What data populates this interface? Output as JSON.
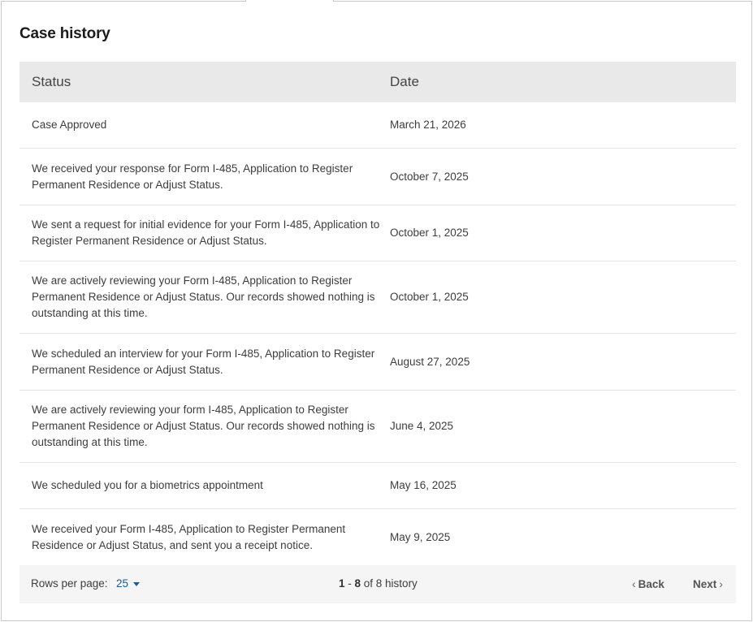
{
  "section_title": "Case history",
  "table": {
    "headers": {
      "status": "Status",
      "date": "Date"
    },
    "rows": [
      {
        "status": "Case Approved",
        "date": "March 21, 2026"
      },
      {
        "status": "We received your response for Form I-485, Application to Register Permanent Residence or Adjust Status.",
        "date": "October 7, 2025"
      },
      {
        "status": "We sent a request for initial evidence for your Form I-485, Application to Register Permanent Residence or Adjust Status.",
        "date": "October 1, 2025"
      },
      {
        "status": "We are actively reviewing your Form I-485, Application to Register Permanent Residence or Adjust Status. Our records showed nothing is outstanding at this time.",
        "date": "October 1, 2025"
      },
      {
        "status": "We scheduled an interview for your Form I-485, Application to Register Permanent Residence or Adjust Status.",
        "date": "August 27, 2025"
      },
      {
        "status": "We are actively reviewing your form I-485, Application to Register Permanent Residence or Adjust Status. Our records showed nothing is outstanding at this time.",
        "date": "June 4, 2025"
      },
      {
        "status": "We scheduled you for a biometrics appointment",
        "date": "May 16, 2025"
      },
      {
        "status": "We received your Form I-485, Application to Register Permanent Residence or Adjust Status, and sent you a receipt notice.",
        "date": "May 9, 2025"
      }
    ]
  },
  "pagination": {
    "rows_per_page_label": "Rows per page:",
    "rows_per_page_value": "25",
    "range_start": "1",
    "range_sep": " - ",
    "range_end": "8",
    "range_of": " of 8 history",
    "back_label": "Back",
    "next_label": "Next"
  },
  "colors": {
    "header_bg": "#e9e9e9",
    "footer_bg": "#f5f5f5",
    "link": "#1a5a96"
  }
}
